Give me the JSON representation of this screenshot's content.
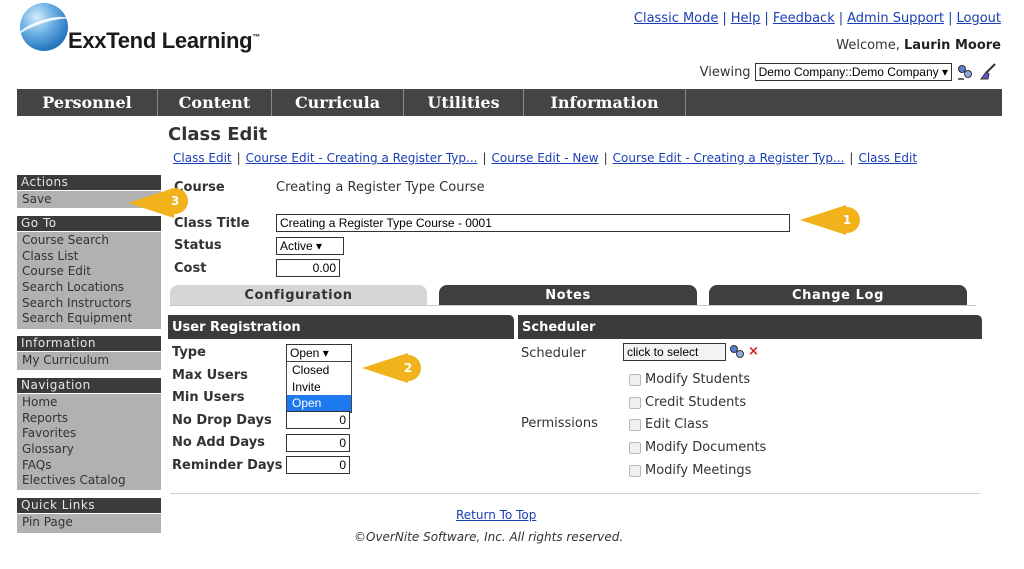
{
  "header": {
    "logo_text": "ExxTend Learning",
    "logo_tm": "™",
    "links": [
      "Classic Mode",
      "Help",
      "Feedback",
      "Admin Support",
      "Logout"
    ],
    "welcome_prefix": "Welcome,",
    "user_name": "Laurin Moore",
    "viewing_label": "Viewing",
    "viewing_value": "Demo Company::Demo Company"
  },
  "nav": [
    "Personnel",
    "Content",
    "Curricula",
    "Utilities",
    "Information"
  ],
  "sidebar": {
    "actions": {
      "title": "Actions",
      "items": [
        "Save"
      ]
    },
    "goto": {
      "title": "Go To",
      "items": [
        "Course Search",
        "Class List",
        "Course Edit",
        "Search Locations",
        "Search Instructors",
        "Search Equipment"
      ]
    },
    "information": {
      "title": "Information",
      "items": [
        "My Curriculum"
      ]
    },
    "navigation": {
      "title": "Navigation",
      "items": [
        "Home",
        "Reports",
        "Favorites",
        "Glossary",
        "FAQs",
        "Electives Catalog"
      ]
    },
    "quick_links": {
      "title": "Quick Links",
      "items": [
        "Pin Page"
      ]
    }
  },
  "page": {
    "title": "Class Edit",
    "breadcrumbs": [
      "Class Edit",
      "Course Edit - Creating a Register Typ...",
      "Course Edit - New",
      "Course Edit - Creating a Register Typ...",
      "Class Edit"
    ],
    "course_label": "Course",
    "course_value": "Creating a Register Type Course",
    "class_title_label": "Class Title",
    "class_title_value": "Creating a Register Type Course - 0001",
    "status_label": "Status",
    "status_value": "Active",
    "cost_label": "Cost",
    "cost_value": "0.00"
  },
  "tabs": [
    "Configuration",
    "Notes",
    "Change Log"
  ],
  "user_registration": {
    "title": "User Registration",
    "type_label": "Type",
    "type_value": "Open",
    "type_options": [
      "Closed",
      "Invite",
      "Open"
    ],
    "max_users_label": "Max Users",
    "min_users_label": "Min Users",
    "no_drop_days_label": "No Drop Days",
    "no_drop_days_value": "0",
    "no_add_days_label": "No Add Days",
    "no_add_days_value": "0",
    "reminder_days_label": "Reminder Days",
    "reminder_days_value": "0"
  },
  "scheduler": {
    "title": "Scheduler",
    "scheduler_label": "Scheduler",
    "scheduler_placeholder": "click to select",
    "permissions_label": "Permissions",
    "checkboxes": [
      "Modify Students",
      "Credit Students",
      "Edit Class",
      "Modify Documents",
      "Modify Meetings"
    ]
  },
  "callouts": [
    "1",
    "2",
    "3"
  ],
  "footer": {
    "return_to_top": "Return To Top",
    "copyright": "©OverNite Software, Inc. All rights reserved."
  },
  "colors": {
    "callout": "#f2b21b",
    "nav_bg": "#444444",
    "link": "#1a3eb4",
    "sidebar_body": "#b1b1b1"
  }
}
